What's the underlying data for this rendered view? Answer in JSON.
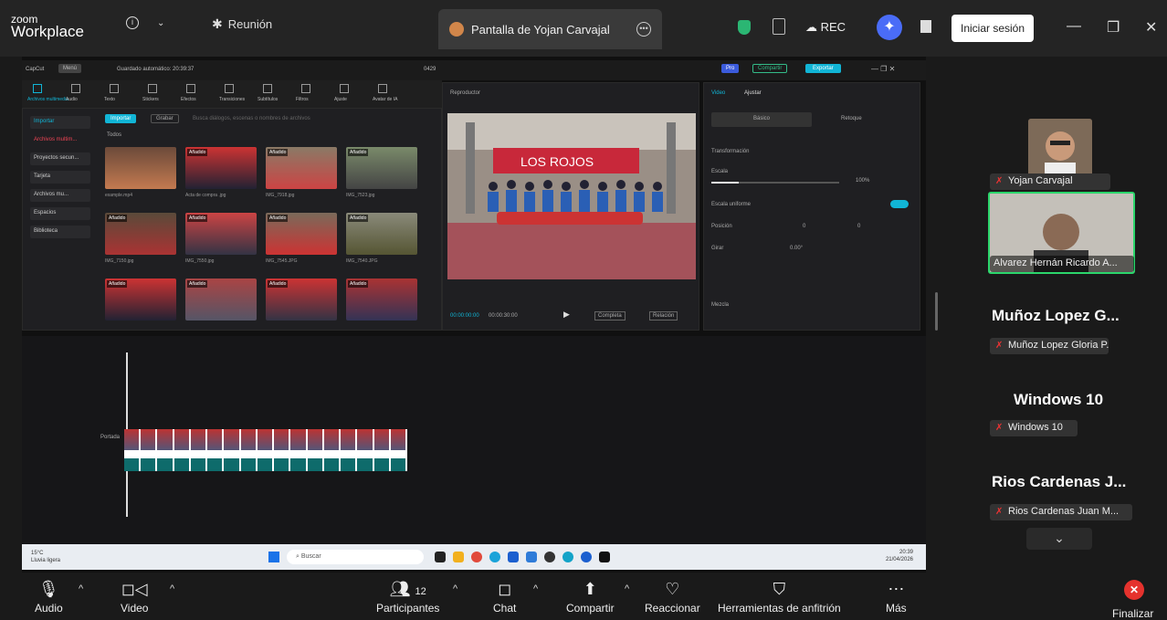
{
  "app": {
    "logo_line1": "zoom",
    "logo_line2": "Workplace"
  },
  "topbar": {
    "meeting_label": "Reunión",
    "share_tab": "Pantalla de Yojan Carvajal",
    "rec_label": "REC",
    "signin_label": "Iniciar sesión"
  },
  "shared_screen": {
    "app_title": "CapCut",
    "menu_label": "Menú",
    "autosave": "Guardado automático: 20:39:37",
    "project_id": "0429",
    "pro_label": "Pro",
    "share_label": "Compartir",
    "export_label": "Exportar",
    "tools": [
      "Archivos multimedia",
      "Audio",
      "Texto",
      "Stickers",
      "Efectos",
      "Transiciones",
      "Subtítulos",
      "Filtros",
      "Ajuste",
      "Avatar de IA"
    ],
    "sidebar": [
      "Importar",
      "Archivos multim...",
      "Proyectos secun...",
      "Tarjeta",
      "Archivos mu...",
      "Espacios",
      "Biblioteca"
    ],
    "import_btn": "Importar",
    "record_btn": "Grabar",
    "search_placeholder": "Busca diálogos, escenas o nombres de archivos",
    "all_label": "Todos",
    "added_badge": "Añadido",
    "files": [
      "example.mp4",
      "Acta de compra .jpg",
      "IMG_7918.jpg",
      "IMG_7523.jpg",
      "IMG_7150.jpg",
      "IMG_7550.jpg",
      "IMG_7545.JPG",
      "IMG_7540.JPG",
      "",
      "",
      "",
      ""
    ],
    "player_title": "Reproductor",
    "timecode": "00:00:00:00",
    "duration": "00:00:30:00",
    "complete_label": "Completa",
    "ratio_label": "Relación",
    "props_tabs": [
      "Video",
      "Ajustar"
    ],
    "props_subtabs": [
      "Básico",
      "Retoque"
    ],
    "transform_label": "Transformación",
    "scale_label": "Escala",
    "scale_value": "100%",
    "uniform_label": "Escala uniforme",
    "position_label": "Posición",
    "pos_x": "0",
    "pos_y": "0",
    "rotate_label": "Girar",
    "rotate_value": "0.00°",
    "blend_label": "Mezcla",
    "track_label": "Portada",
    "taskbar": {
      "weather_temp": "15°C",
      "weather_desc": "Lluvia ligera",
      "search": "Buscar",
      "time": "20:39",
      "date": "21/04/2026"
    }
  },
  "participants": {
    "p1_name": "Yojan Carvajal",
    "p2_name": "Alvarez Hernán Ricardo A...",
    "p3_big": "Muñoz Lopez G...",
    "p3_tag": "Muñoz Lopez Gloria P...",
    "p4_big": "Windows 10",
    "p4_tag": "Windows 10",
    "p5_big": "Rios Cardenas J...",
    "p5_tag": "Rios Cardenas Juan M..."
  },
  "bottombar": {
    "audio": "Audio",
    "video": "Video",
    "participants": "Participantes",
    "participants_count": "12",
    "chat": "Chat",
    "share": "Compartir",
    "react": "Reaccionar",
    "host_tools": "Herramientas de anfitrión",
    "more": "Más",
    "end": "Finalizar"
  }
}
